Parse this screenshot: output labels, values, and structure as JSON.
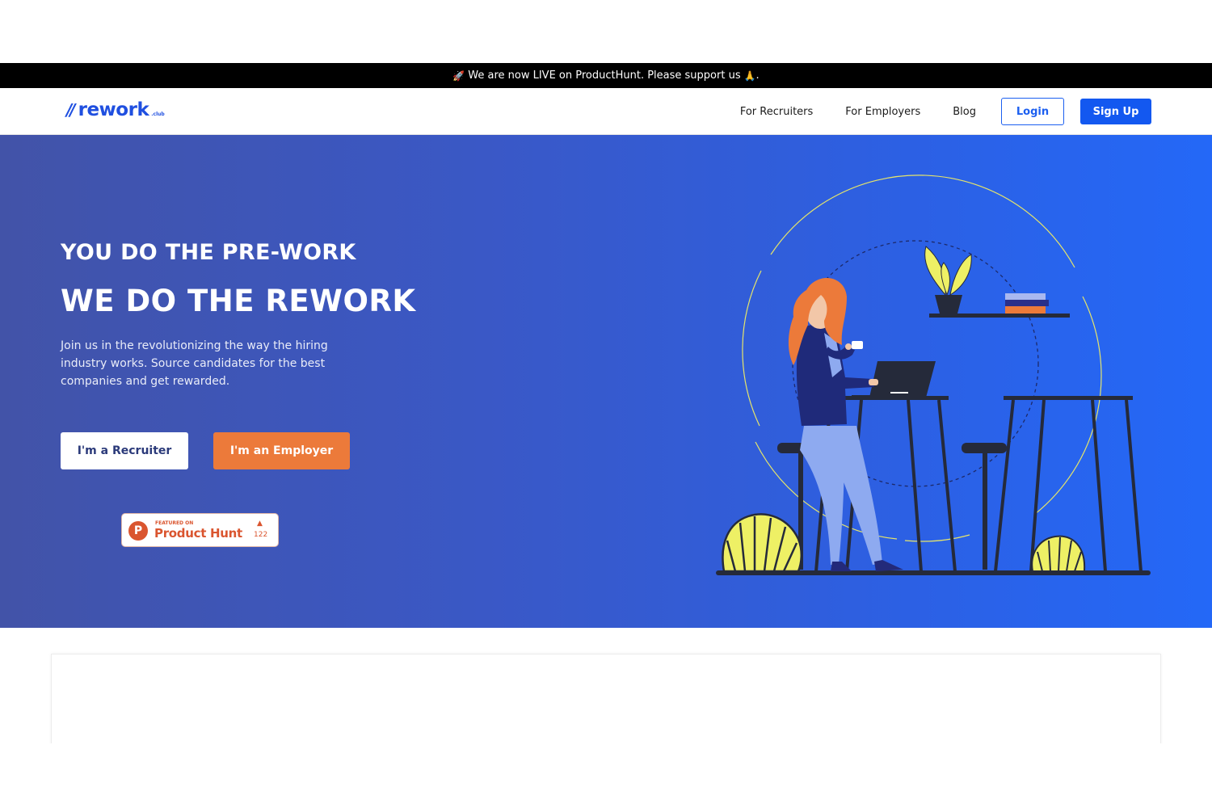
{
  "announcement": {
    "rocket_icon": "🚀",
    "text": "We are now LIVE on ProductHunt. Please support us",
    "pray_icon": "🙏",
    "suffix": "."
  },
  "header": {
    "logo": {
      "mark": "//",
      "name": "rework",
      "suffix": ".club"
    },
    "nav": {
      "recruiters": "For Recruiters",
      "employers": "For Employers",
      "blog": "Blog"
    },
    "login_label": "Login",
    "signup_label": "Sign Up"
  },
  "hero": {
    "subtitle": "YOU DO THE PRE-WORK",
    "title": "WE DO THE REWORK",
    "description": "Join us in the revolutionizing the way the hiring industry works. Source candidates for the best companies and get rewarded.",
    "recruiter_button": "I'm a Recruiter",
    "employer_button": "I'm an Employer",
    "product_hunt": {
      "featured": "FEATURED ON",
      "name": "Product Hunt",
      "logo_letter": "P",
      "arrow": "▲",
      "votes": "122"
    }
  },
  "colors": {
    "brand_blue": "#1358f0",
    "employer_orange": "#ec7a3a",
    "product_hunt": "#da552f",
    "illustration_yellow": "#eef065",
    "dark_furniture": "#252a3a"
  }
}
